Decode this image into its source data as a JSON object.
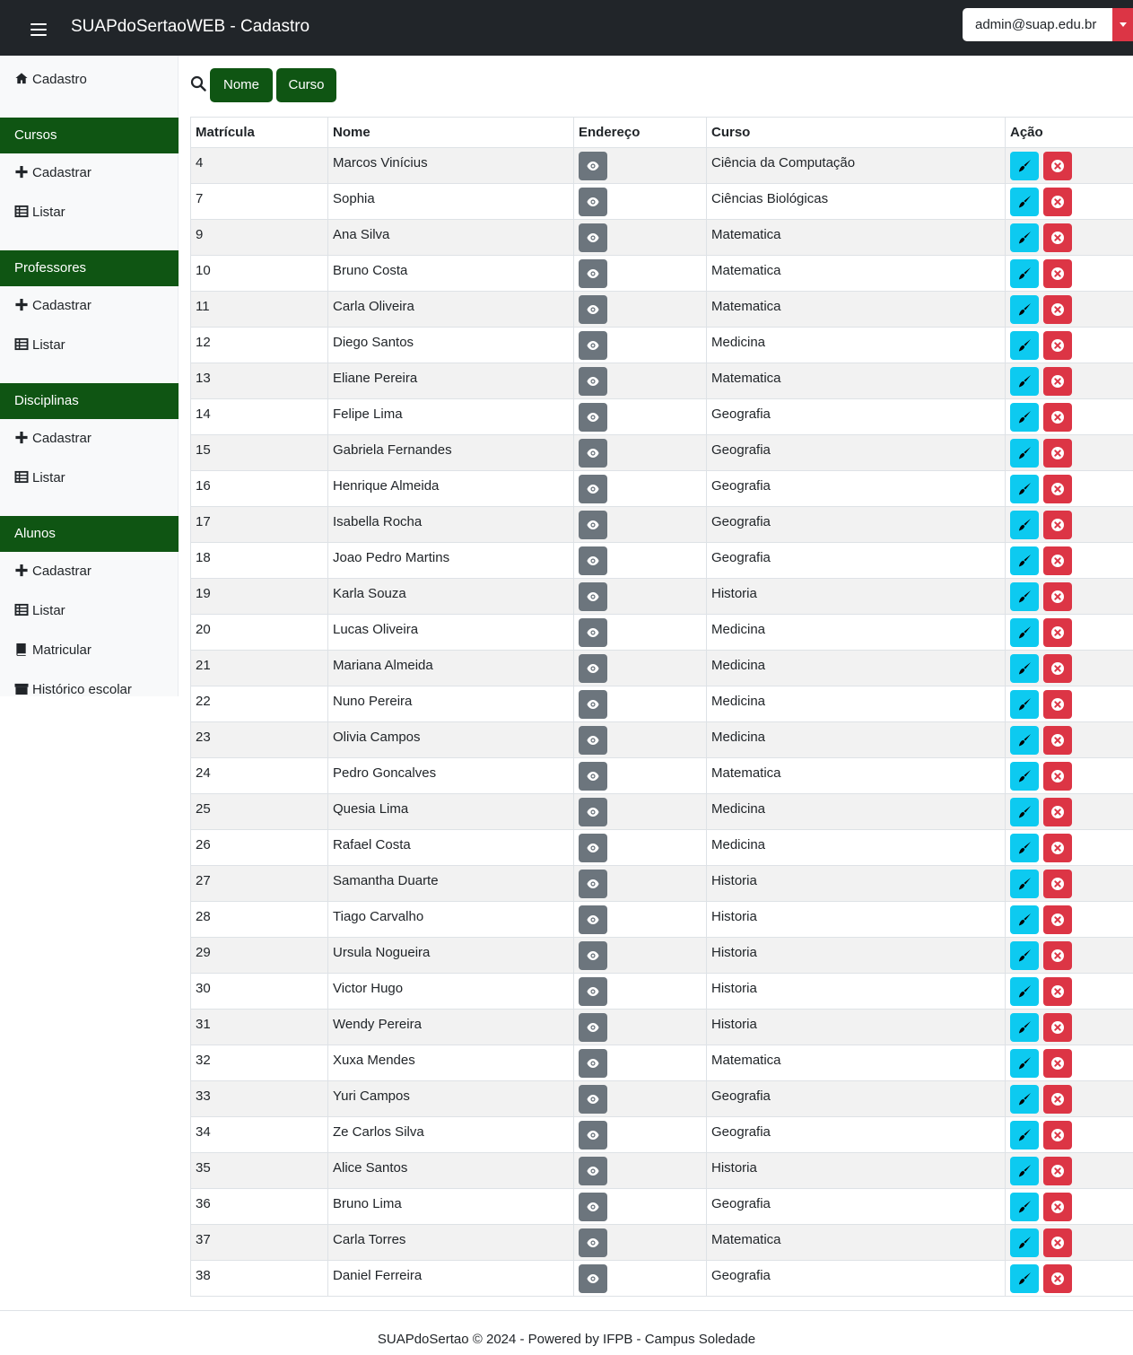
{
  "header": {
    "title": "SUAPdoSertaoWEB - Cadastro",
    "user_email": "admin@suap.edu.br"
  },
  "sidebar": {
    "home_label": "Cadastro",
    "sections": [
      {
        "title": "Cursos",
        "items": [
          "Cadastrar",
          "Listar"
        ]
      },
      {
        "title": "Professores",
        "items": [
          "Cadastrar",
          "Listar"
        ]
      },
      {
        "title": "Disciplinas",
        "items": [
          "Cadastrar",
          "Listar"
        ]
      },
      {
        "title": "Alunos",
        "items": [
          "Cadastrar",
          "Listar",
          "Matricular",
          "Histórico escolar"
        ]
      }
    ]
  },
  "filters": {
    "nome_label": "Nome",
    "curso_label": "Curso"
  },
  "table": {
    "headers": [
      "Matrícula",
      "Nome",
      "Endereço",
      "Curso",
      "Ação"
    ],
    "rows": [
      {
        "matricula": "4",
        "nome": "Marcos Vinícius",
        "curso": "Ciência da Computação"
      },
      {
        "matricula": "7",
        "nome": "Sophia",
        "curso": "Ciências Biológicas"
      },
      {
        "matricula": "9",
        "nome": "Ana Silva",
        "curso": "Matematica"
      },
      {
        "matricula": "10",
        "nome": "Bruno Costa",
        "curso": "Matematica"
      },
      {
        "matricula": "11",
        "nome": "Carla Oliveira",
        "curso": "Matematica"
      },
      {
        "matricula": "12",
        "nome": "Diego Santos",
        "curso": "Medicina"
      },
      {
        "matricula": "13",
        "nome": "Eliane Pereira",
        "curso": "Matematica"
      },
      {
        "matricula": "14",
        "nome": "Felipe Lima",
        "curso": "Geografia"
      },
      {
        "matricula": "15",
        "nome": "Gabriela Fernandes",
        "curso": "Geografia"
      },
      {
        "matricula": "16",
        "nome": "Henrique Almeida",
        "curso": "Geografia"
      },
      {
        "matricula": "17",
        "nome": "Isabella Rocha",
        "curso": "Geografia"
      },
      {
        "matricula": "18",
        "nome": "Joao Pedro Martins",
        "curso": "Geografia"
      },
      {
        "matricula": "19",
        "nome": "Karla Souza",
        "curso": "Historia"
      },
      {
        "matricula": "20",
        "nome": "Lucas Oliveira",
        "curso": "Medicina"
      },
      {
        "matricula": "21",
        "nome": "Mariana Almeida",
        "curso": "Medicina"
      },
      {
        "matricula": "22",
        "nome": "Nuno Pereira",
        "curso": "Medicina"
      },
      {
        "matricula": "23",
        "nome": "Olivia Campos",
        "curso": "Medicina"
      },
      {
        "matricula": "24",
        "nome": "Pedro Goncalves",
        "curso": "Matematica"
      },
      {
        "matricula": "25",
        "nome": "Quesia Lima",
        "curso": "Medicina"
      },
      {
        "matricula": "26",
        "nome": "Rafael Costa",
        "curso": "Medicina"
      },
      {
        "matricula": "27",
        "nome": "Samantha Duarte",
        "curso": "Historia"
      },
      {
        "matricula": "28",
        "nome": "Tiago Carvalho",
        "curso": "Historia"
      },
      {
        "matricula": "29",
        "nome": "Ursula Nogueira",
        "curso": "Historia"
      },
      {
        "matricula": "30",
        "nome": "Victor Hugo",
        "curso": "Historia"
      },
      {
        "matricula": "31",
        "nome": "Wendy Pereira",
        "curso": "Historia"
      },
      {
        "matricula": "32",
        "nome": "Xuxa Mendes",
        "curso": "Matematica"
      },
      {
        "matricula": "33",
        "nome": "Yuri Campos",
        "curso": "Geografia"
      },
      {
        "matricula": "34",
        "nome": "Ze Carlos Silva",
        "curso": "Geografia"
      },
      {
        "matricula": "35",
        "nome": "Alice Santos",
        "curso": "Historia"
      },
      {
        "matricula": "36",
        "nome": "Bruno Lima",
        "curso": "Geografia"
      },
      {
        "matricula": "37",
        "nome": "Carla Torres",
        "curso": "Matematica"
      },
      {
        "matricula": "38",
        "nome": "Daniel Ferreira",
        "curso": "Geografia"
      }
    ]
  },
  "footer": {
    "text": "SUAPdoSertao © 2024 - Powered by IFPB - Campus Soledade"
  },
  "icons": {
    "menu": "hamburger-menu-icon",
    "home": "home-icon",
    "add": "plus-icon",
    "list": "table-list-icon",
    "enroll": "book-icon",
    "history": "archive-icon",
    "search": "search-icon",
    "view": "eye-icon",
    "edit": "brush-icon",
    "delete": "x-circle-icon"
  },
  "colors": {
    "topbar": "#212529",
    "brand_green": "#0f5513",
    "danger": "#dc3545",
    "info": "#0dcaf0",
    "secondary": "#6c757d"
  }
}
